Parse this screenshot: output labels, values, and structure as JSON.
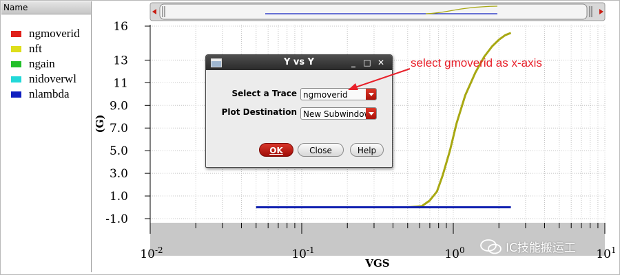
{
  "legend": {
    "header": "Name",
    "items": [
      {
        "label": "ngmoverid",
        "color": "#e0201a"
      },
      {
        "label": "nft",
        "color": "#dede1a"
      },
      {
        "label": "ngain",
        "color": "#22c02a"
      },
      {
        "label": "nidoverwl",
        "color": "#22d8d8"
      },
      {
        "label": "nlambda",
        "color": "#1020c0"
      }
    ]
  },
  "chart_data": {
    "type": "line",
    "x_scale": "log",
    "xlim": [
      0.01,
      10
    ],
    "ylim": [
      -1.0,
      16
    ],
    "xlabel": "VGS",
    "ylabel": "(G)",
    "x_ticks": [
      {
        "base": "10",
        "exp": "-2"
      },
      {
        "base": "10",
        "exp": "-1"
      },
      {
        "base": "10",
        "exp": "0"
      },
      {
        "base": "10",
        "exp": "1"
      }
    ],
    "y_ticks": [
      "16",
      "13",
      "11",
      "9.0",
      "7.0",
      "5.0",
      "3.0",
      "1.0",
      "-1.0"
    ],
    "y_tick_values": [
      16,
      13,
      11,
      9.0,
      7.0,
      5.0,
      3.0,
      1.0,
      -1.0
    ],
    "grid": true,
    "series": [
      {
        "name": "nft",
        "color": "#a8a812",
        "x": [
          0.05,
          0.5,
          0.62,
          0.7,
          0.78,
          0.85,
          0.95,
          1.05,
          1.2,
          1.4,
          1.6,
          1.8,
          2.0,
          2.2,
          2.4
        ],
        "y": [
          0.0,
          0.0,
          0.1,
          0.6,
          1.4,
          2.8,
          5.0,
          7.4,
          9.9,
          11.9,
          13.3,
          14.2,
          14.8,
          15.2,
          15.4
        ]
      },
      {
        "name": "nlambda",
        "color": "#1020b0",
        "x": [
          0.05,
          2.4
        ],
        "y": [
          0.0,
          0.0
        ]
      }
    ]
  },
  "dialog": {
    "title": "Y vs Y",
    "minimize": "_",
    "maximize": "□",
    "close": "✕",
    "trace_label": "Select a Trace",
    "trace_value": "ngmoverid",
    "dest_label": "Plot Destination",
    "dest_value": "New Subwindow",
    "ok": "OK",
    "close_btn": "Close",
    "help": "Help"
  },
  "annotation": "select gmoverid as x-axis",
  "watermark": "IC技能搬运工",
  "colors": {
    "ok_button": "#c01a12",
    "annotation": "#e8202a",
    "combo_button": "#c81e14"
  }
}
